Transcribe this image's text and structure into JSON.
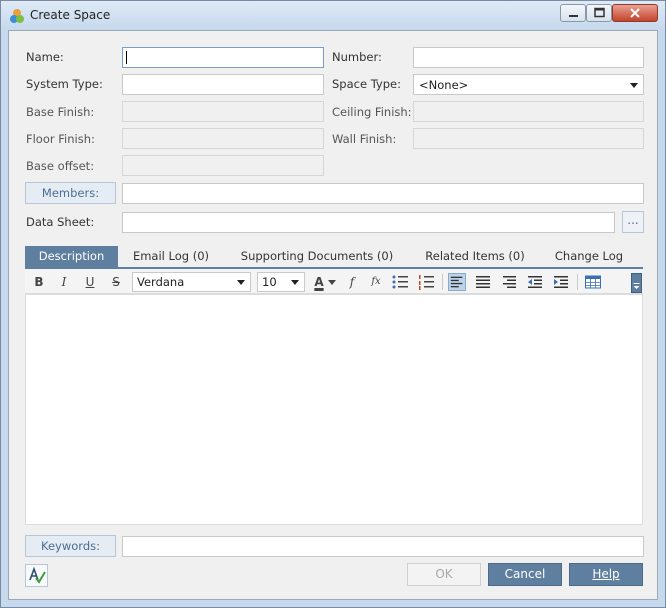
{
  "window": {
    "title": "Create Space"
  },
  "form": {
    "name": {
      "label": "Name:",
      "value": ""
    },
    "number": {
      "label": "Number:",
      "value": ""
    },
    "system_type": {
      "label": "System Type:",
      "value": ""
    },
    "space_type": {
      "label": "Space Type:",
      "value": "<None>"
    },
    "base_finish": {
      "label": "Base Finish:",
      "value": ""
    },
    "ceiling_finish": {
      "label": "Ceiling Finish:",
      "value": ""
    },
    "floor_finish": {
      "label": "Floor Finish:",
      "value": ""
    },
    "wall_finish": {
      "label": "Wall Finish:",
      "value": ""
    },
    "base_offset": {
      "label": "Base offset:",
      "value": ""
    },
    "members": {
      "label": "Members:",
      "value": ""
    },
    "data_sheet": {
      "label": "Data Sheet:",
      "value": "",
      "browse_label": "..."
    }
  },
  "tabs": [
    {
      "label": "Description",
      "active": true
    },
    {
      "label": "Email Log (0)"
    },
    {
      "label": "Supporting Documents (0)"
    },
    {
      "label": "Related Items (0)"
    },
    {
      "label": "Change Log"
    }
  ],
  "toolbar": {
    "bold": "B",
    "italic": "I",
    "underline": "U",
    "strike": "S",
    "font": "Verdana",
    "size": "10",
    "font_color": "A",
    "formula": "f",
    "fx": "fx"
  },
  "keywords": {
    "label": "Keywords:",
    "value": ""
  },
  "buttons": {
    "ok": "OK",
    "cancel": "Cancel",
    "help": "Help"
  },
  "colors": {
    "accent": "#5e7f9f",
    "window_frame": "#c7d9ed",
    "close": "#c4432b"
  }
}
